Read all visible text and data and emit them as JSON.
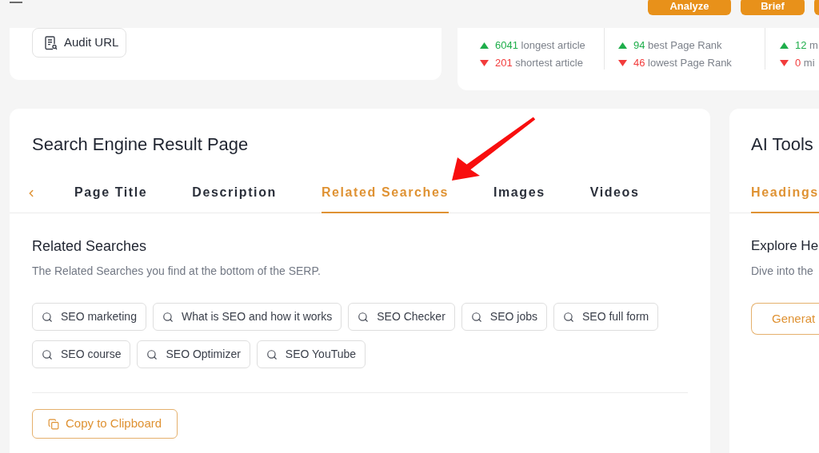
{
  "header": {
    "buttons": [
      {
        "label": "Analyze"
      },
      {
        "label": "Brief"
      }
    ]
  },
  "audit_card": {
    "button": "Audit URL"
  },
  "stats": {
    "columns": [
      {
        "rows": [
          {
            "kind": "up",
            "count": "6041",
            "caption": "longest article"
          },
          {
            "kind": "down",
            "count": "201",
            "caption": "shortest article"
          }
        ]
      },
      {
        "rows": [
          {
            "kind": "up",
            "count": "94",
            "caption": "best Page Rank"
          },
          {
            "kind": "down",
            "count": "46",
            "caption": "lowest Page Rank"
          }
        ]
      },
      {
        "rows": [
          {
            "kind": "up",
            "count": "12",
            "caption": "m"
          },
          {
            "kind": "down",
            "count": "0",
            "caption": "mi"
          }
        ]
      }
    ]
  },
  "serp_card": {
    "title": "Search Engine Result Page",
    "tabs": [
      {
        "label": "Page Title",
        "selected": false
      },
      {
        "label": "Description",
        "selected": false
      },
      {
        "label": "Related Searches",
        "selected": true
      },
      {
        "label": "Images",
        "selected": false
      },
      {
        "label": "Videos",
        "selected": false
      }
    ],
    "section": {
      "heading": "Related Searches",
      "description": "The Related Searches you find at the bottom of the SERP.",
      "chips": [
        "SEO marketing",
        "What is SEO and how it works",
        "SEO Checker",
        "SEO jobs",
        "SEO full form",
        "SEO course",
        "SEO Optimizer",
        "SEO YouTube"
      ]
    },
    "copy_button": "Copy to Clipboard"
  },
  "ai_tools_card": {
    "title": "AI Tools",
    "tabs": [
      {
        "label": "Headings",
        "selected": true
      }
    ],
    "heading": "Explore He",
    "description": "Dive into the",
    "button": "Generat"
  }
}
